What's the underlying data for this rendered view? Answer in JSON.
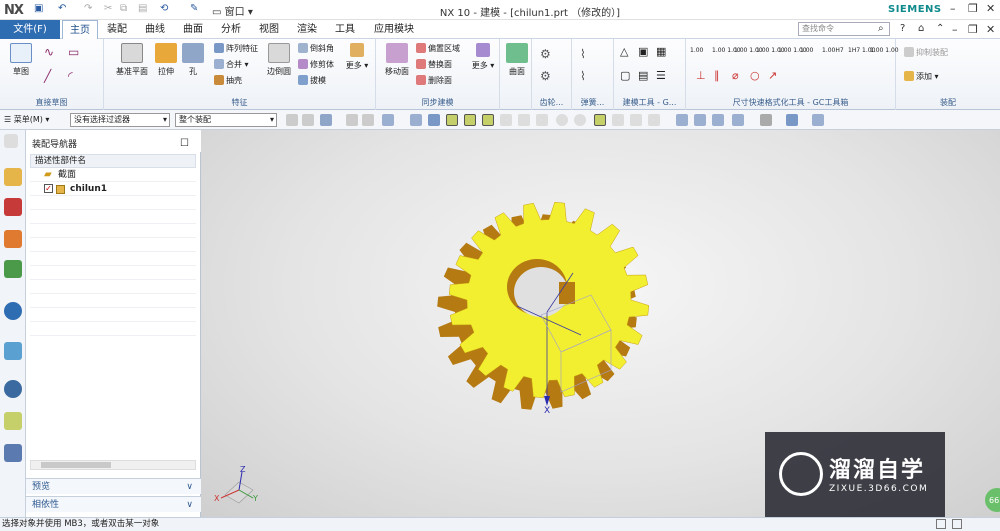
{
  "app": {
    "logo": "NX",
    "window_title": "NX 10 - 建模 - [chilun1.prt （修改的）]",
    "brand": "SIEMENS"
  },
  "quick_access": {
    "window_menu": "窗口"
  },
  "menubar": {
    "file": "文件(F)",
    "tabs": [
      "主页",
      "装配",
      "曲线",
      "曲面",
      "分析",
      "视图",
      "渲染",
      "工具",
      "应用模块"
    ],
    "active_tab": "主页",
    "search_placeholder": "查找命令"
  },
  "ribbon": {
    "groups": {
      "direct_sketch": "直接草图",
      "feature": "特征",
      "sync_modeling": "同步建模",
      "gear": "齿轮...",
      "spring": "弹簧...",
      "modeling_tools": "建模工具 - G...",
      "dimension_tools": "尺寸快速格式化工具 - GC工具箱",
      "assembly": "装配"
    },
    "buttons": {
      "sketch": "草图",
      "datum_plane": "基准平面",
      "extrude": "拉伸",
      "hole": "孔",
      "pattern_feature": "阵列特征",
      "unite": "合并",
      "shell": "抽壳",
      "edge_blend": "边倒圆",
      "chamfer": "倒斜角",
      "trim_body": "修剪体",
      "draft": "拔模",
      "more1": "更多",
      "move_face": "移动面",
      "offset_region": "偏置区域",
      "replace_face": "替换面",
      "delete_face": "删除面",
      "more2": "更多",
      "surface": "曲面",
      "suppress_assembly": "抑制装配",
      "add": "添加"
    },
    "dim_labels": [
      "1.00",
      "1.00\n1.00",
      "1.00\n1.00",
      "1.00\n1.00",
      "1.00\n1.00",
      "1.00",
      "1.00H7",
      "1H7\n1.00",
      "1.00\n1.00"
    ]
  },
  "toolbar2": {
    "menu": "菜单(M)",
    "filter": "没有选择过滤器",
    "scope": "整个装配"
  },
  "navigator": {
    "title": "装配导航器",
    "column_header": "描述性部件名",
    "rows": [
      "截面",
      "chilun1"
    ],
    "preview": "预览",
    "dependencies": "相依性"
  },
  "viewport": {
    "axis_x": "X",
    "triad_z": "Z",
    "triad_x": "X",
    "triad_y": "Y",
    "bubble": "66"
  },
  "status": {
    "text": "选择对象并使用 MB3，或者双击某一对象"
  },
  "watermark": {
    "title": "溜溜自学",
    "url": "ZIXUE.3D66.COM"
  },
  "colors": {
    "accent": "#2f6db3",
    "gear_face": "#f2ee30",
    "gear_side": "#b57a12",
    "brand": "#0f8a8c"
  }
}
